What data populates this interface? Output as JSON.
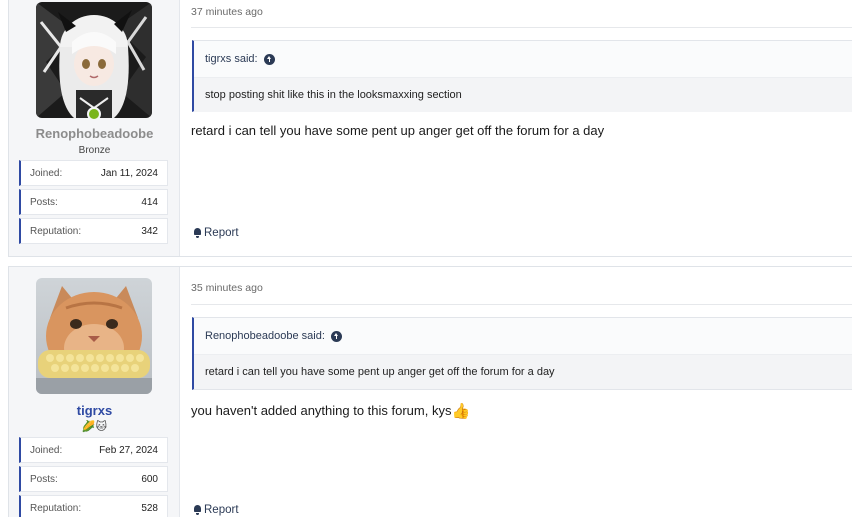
{
  "posts": [
    {
      "user": {
        "name": "Renophobeadoobe",
        "title": "Bronze",
        "online": true,
        "avatar_icon": "anime-girl-avatar",
        "stats": [
          {
            "label": "Joined:",
            "value": "Jan 11, 2024"
          },
          {
            "label": "Posts:",
            "value": "414"
          },
          {
            "label": "Reputation:",
            "value": "342"
          }
        ]
      },
      "timestamp": "37 minutes ago",
      "quote": {
        "author_label": "tigrxs said:",
        "text": "stop posting shit like this in the looksmaxxing section"
      },
      "message": "retard i can tell you have some pent up anger get off the forum for a day",
      "report_label": "Report"
    },
    {
      "user": {
        "name": "tigrxs",
        "title_icons": [
          "corn-emoji",
          "cat-emoji"
        ],
        "title_glyphs": "🌽🐱",
        "avatar_icon": "cat-eating-corn-avatar",
        "stats": [
          {
            "label": "Joined:",
            "value": "Feb 27, 2024"
          },
          {
            "label": "Posts:",
            "value": "600"
          },
          {
            "label": "Reputation:",
            "value": "528"
          }
        ]
      },
      "timestamp": "35 minutes ago",
      "quote": {
        "author_label": "Renophobeadoobe said:",
        "text": "retard i can tell you have some pent up anger get off the forum for a day"
      },
      "message": "you haven't added anything to this forum, kys",
      "message_emoji": "👍",
      "report_label": "Report"
    }
  ],
  "colors": {
    "accent": "#2f4aa3",
    "online": "#7ab51d",
    "username_muted": "#8c8c8c"
  }
}
